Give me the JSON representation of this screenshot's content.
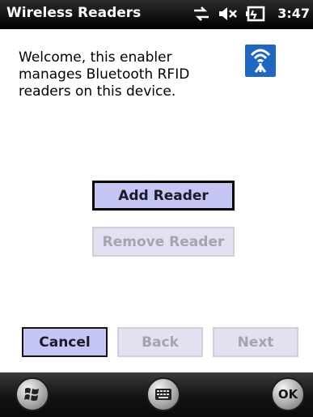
{
  "titlebar": {
    "title": "Wireless Readers",
    "time": "3:47",
    "icons": [
      "connectivity-icon",
      "volume-muted-icon",
      "battery-charging-icon"
    ]
  },
  "content": {
    "welcome_text": "Welcome, this enabler manages Bluetooth RFID readers on this device.",
    "app_icon": "rfid-antenna-icon"
  },
  "buttons": {
    "add_reader": "Add Reader",
    "remove_reader": "Remove Reader",
    "cancel": "Cancel",
    "back": "Back",
    "next": "Next"
  },
  "taskbar": {
    "start_icon": "windows-logo-icon",
    "keyboard_icon": "keyboard-icon",
    "ok_label": "OK"
  },
  "colors": {
    "title_bar": "#000000",
    "button_enabled": "#c5c6f4",
    "button_disabled": "#e1e1f1",
    "app_icon_bg": "#1f67c0"
  }
}
